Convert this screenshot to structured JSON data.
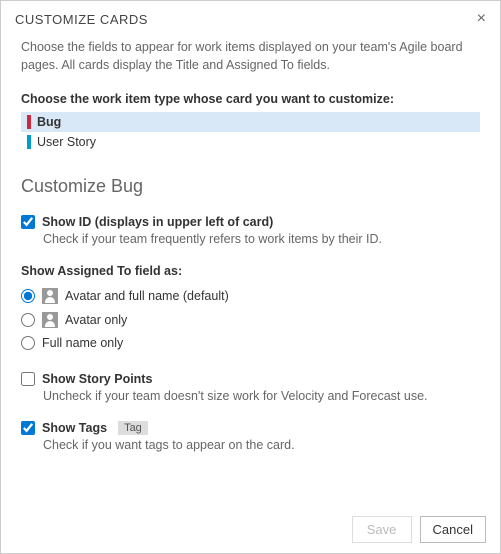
{
  "header": {
    "title": "CUSTOMIZE CARDS"
  },
  "intro": "Choose the fields to appear for work items displayed on your team's Agile board pages. All cards display the Title and Assigned To fields.",
  "wit": {
    "prompt": "Choose the work item type whose card you want to customize:",
    "items": [
      {
        "label": "Bug",
        "selected": true
      },
      {
        "label": "User Story",
        "selected": false
      }
    ]
  },
  "subheader": "Customize Bug",
  "showId": {
    "label": "Show ID (displays in upper left of card)",
    "checked": true,
    "hint": "Check if your team frequently refers to work items by their ID."
  },
  "assignedTo": {
    "label": "Show Assigned To field as:",
    "options": [
      {
        "label": "Avatar and full name (default)",
        "icon": true,
        "checked": true
      },
      {
        "label": "Avatar only",
        "icon": true,
        "checked": false
      },
      {
        "label": "Full name only",
        "icon": false,
        "checked": false
      }
    ]
  },
  "storyPoints": {
    "label": "Show Story Points",
    "checked": false,
    "hint": "Uncheck if your team doesn't size work for Velocity and Forecast use."
  },
  "showTags": {
    "label": "Show Tags",
    "checked": true,
    "badge": "Tag",
    "hint": "Check if you want tags to appear on the card."
  },
  "footer": {
    "save": "Save",
    "cancel": "Cancel"
  }
}
